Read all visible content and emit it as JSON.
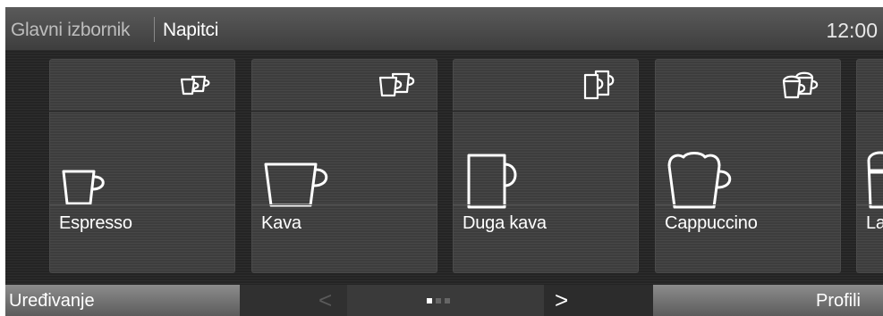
{
  "header": {
    "menu_label": "Glavni izbornik",
    "current_label": "Napitci",
    "clock": "12:00"
  },
  "tiles": [
    {
      "label": "Espresso",
      "icon": "espresso-cup-icon"
    },
    {
      "label": "Kava",
      "icon": "coffee-cup-icon"
    },
    {
      "label": "Duga kava",
      "icon": "long-coffee-mug-icon"
    },
    {
      "label": "Cappuccino",
      "icon": "cappuccino-cup-icon"
    },
    {
      "label": "La",
      "icon": "latte-glass-icon"
    }
  ],
  "footer": {
    "edit_label": "Uređivanje",
    "prev_label": "<",
    "next_label": ">",
    "profiles_label": "Profili",
    "page": {
      "current": 1,
      "total": 3
    }
  },
  "colors": {
    "background": "#242424",
    "header": "#4a4a4a",
    "tile": "#3d3d3d",
    "footer_button": "#787878",
    "text": "#ffffff",
    "dot_active": "#ffffff",
    "dot_inactive": "#666666"
  }
}
